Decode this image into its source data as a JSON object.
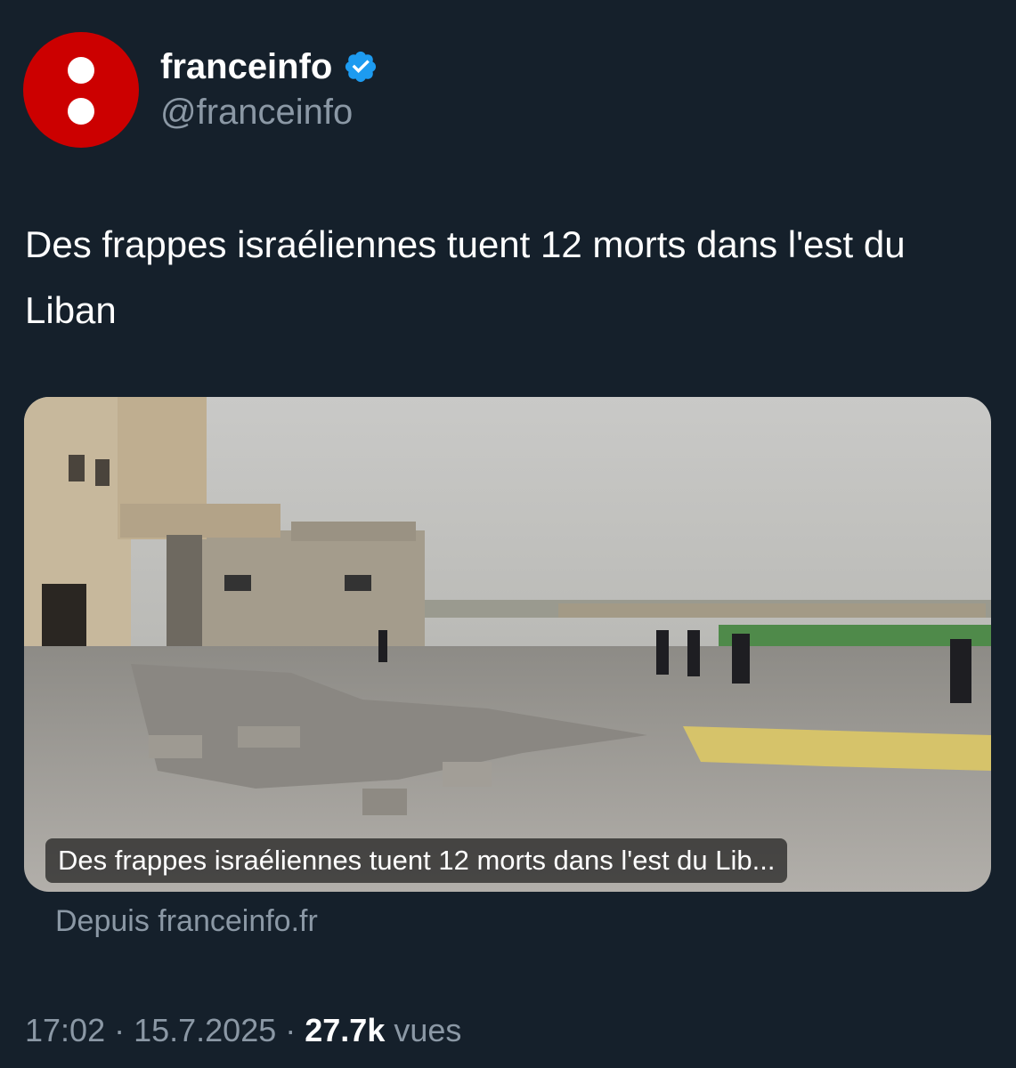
{
  "account": {
    "display_name": "franceinfo",
    "handle": "@franceinfo",
    "avatar_icon": "franceinfo-logo-icon",
    "verified_icon": "verified-badge-icon",
    "brand_color": "#cc0000",
    "verified_color": "#1d9bf0"
  },
  "tweet": {
    "text": "Des frappes israéliennes tuent 12 morts dans l'est du Liban"
  },
  "card": {
    "caption": "Des frappes israéliennes tuent 12 morts dans l'est du Lib...",
    "source": "Depuis franceinfo.fr"
  },
  "meta": {
    "time": "17:02",
    "separator": " · ",
    "date": "15.7.2025",
    "views_count": "27.7k",
    "views_label": " vues"
  },
  "colors": {
    "background": "#15202b",
    "text_primary": "#ffffff",
    "text_secondary": "#8b98a5"
  }
}
